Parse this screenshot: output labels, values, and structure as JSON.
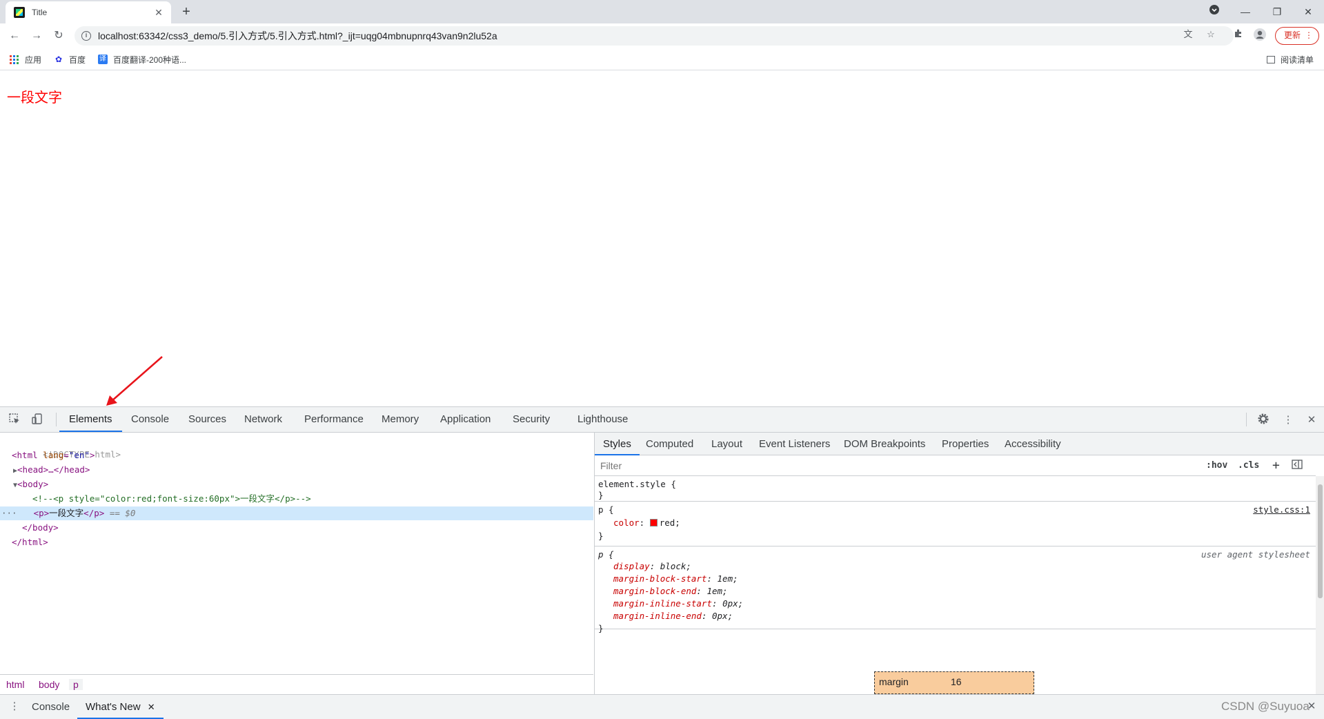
{
  "browser": {
    "tab_title": "Title",
    "tab_close": "✕",
    "new_tab": "+",
    "url": "localhost:63342/css3_demo/5.引入方式/5.引入方式.html?_ijt=uqg04mbnupnrq43van9n2lu52a",
    "update_label": "更新",
    "bookmarks": [
      "应用",
      "百度",
      "百度翻译-200种语..."
    ],
    "reading_list": "阅读清单"
  },
  "page": {
    "text": "一段文字",
    "text_color": "#ff0000"
  },
  "devtools": {
    "tabs": [
      "Elements",
      "Console",
      "Sources",
      "Network",
      "Performance",
      "Memory",
      "Application",
      "Security",
      "Lighthouse"
    ],
    "active_tab": "Elements",
    "dom": {
      "doctype": "<!DOCTYPE html>",
      "html_open_tag": "html",
      "html_lang_attr": "lang",
      "html_lang_val": "\"en\"",
      "head_collapsed": "<head>…</head>",
      "body_open": "<body>",
      "comment": "<!--<p style=\"color:red;font-size:60px\">一段文字</p>-->",
      "p_open": "<p>",
      "p_text": "一段文字",
      "p_close": "</p>",
      "selected_marker": "== $0",
      "body_close": "</body>",
      "html_close": "</html>",
      "row_dots": "···"
    },
    "breadcrumbs": [
      "html",
      "body",
      "p"
    ],
    "styles_tabs": [
      "Styles",
      "Computed",
      "Layout",
      "Event Listeners",
      "DOM Breakpoints",
      "Properties",
      "Accessibility"
    ],
    "filter_placeholder": "Filter",
    "hov": ":hov",
    "cls": ".cls",
    "rules": {
      "element_style_open": "element.style {",
      "close": "}",
      "p_selector": "p {",
      "p_source": "style.css:1",
      "color_prop": "color",
      "color_val": "red;",
      "ua_source": "user agent stylesheet",
      "ua_props": [
        {
          "name": "display",
          "value": "block;"
        },
        {
          "name": "margin-block-start",
          "value": "1em;"
        },
        {
          "name": "margin-block-end",
          "value": "1em;"
        },
        {
          "name": "margin-inline-start",
          "value": "0px;"
        },
        {
          "name": "margin-inline-end",
          "value": "0px;"
        }
      ]
    },
    "box_model": {
      "label": "margin",
      "value": "16"
    },
    "drawer_tabs": [
      "Console",
      "What's New"
    ],
    "drawer_close": "✕",
    "watermark": "CSDN @Suyuoa"
  },
  "colors": {
    "accent": "#1a73e8",
    "selection": "#cfe8fc",
    "annotation_arrow": "#e8141b"
  }
}
